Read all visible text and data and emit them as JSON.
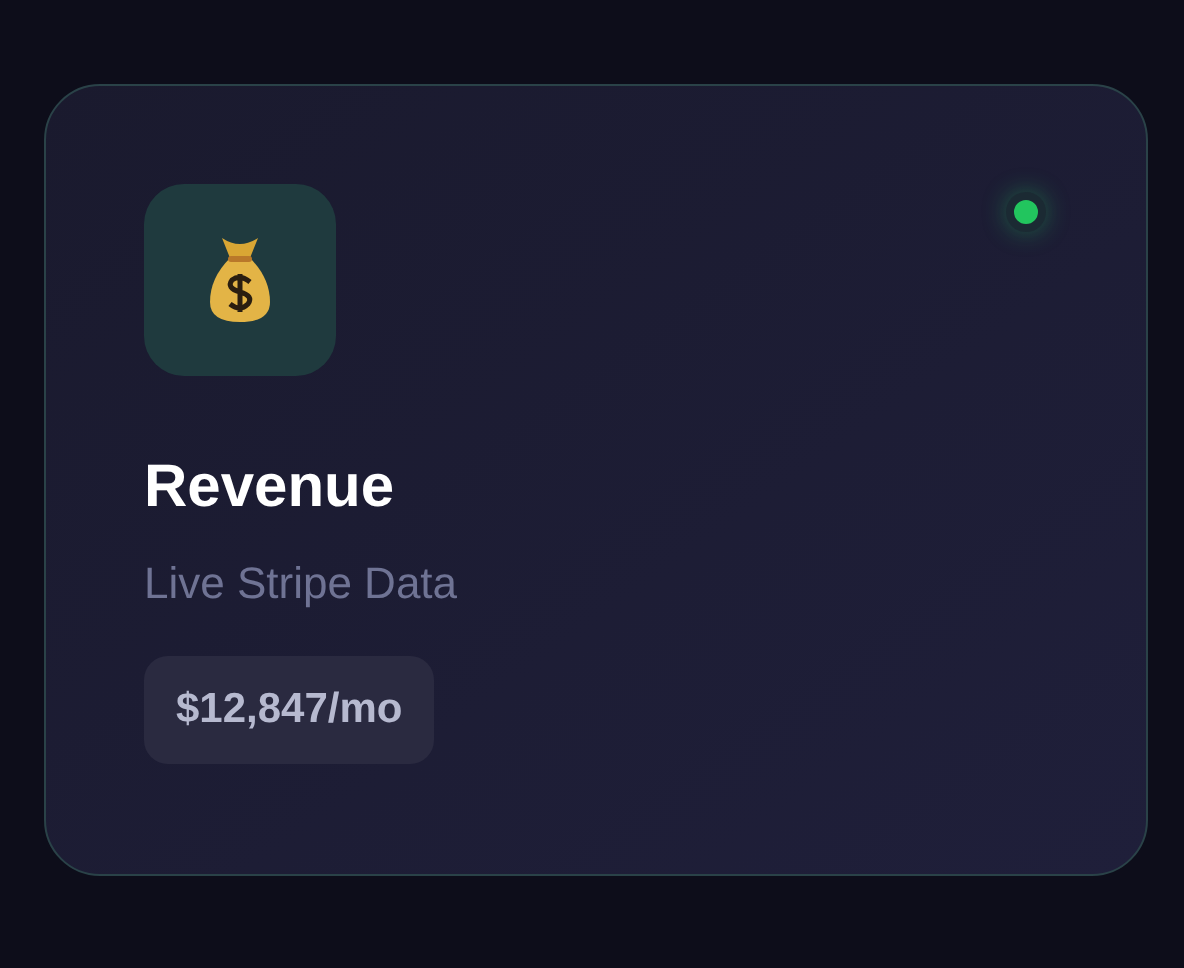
{
  "card": {
    "title": "Revenue",
    "subtitle": "Live Stripe Data",
    "value": "$12,847/mo",
    "status": {
      "on": true,
      "color": "#22c55e"
    }
  }
}
